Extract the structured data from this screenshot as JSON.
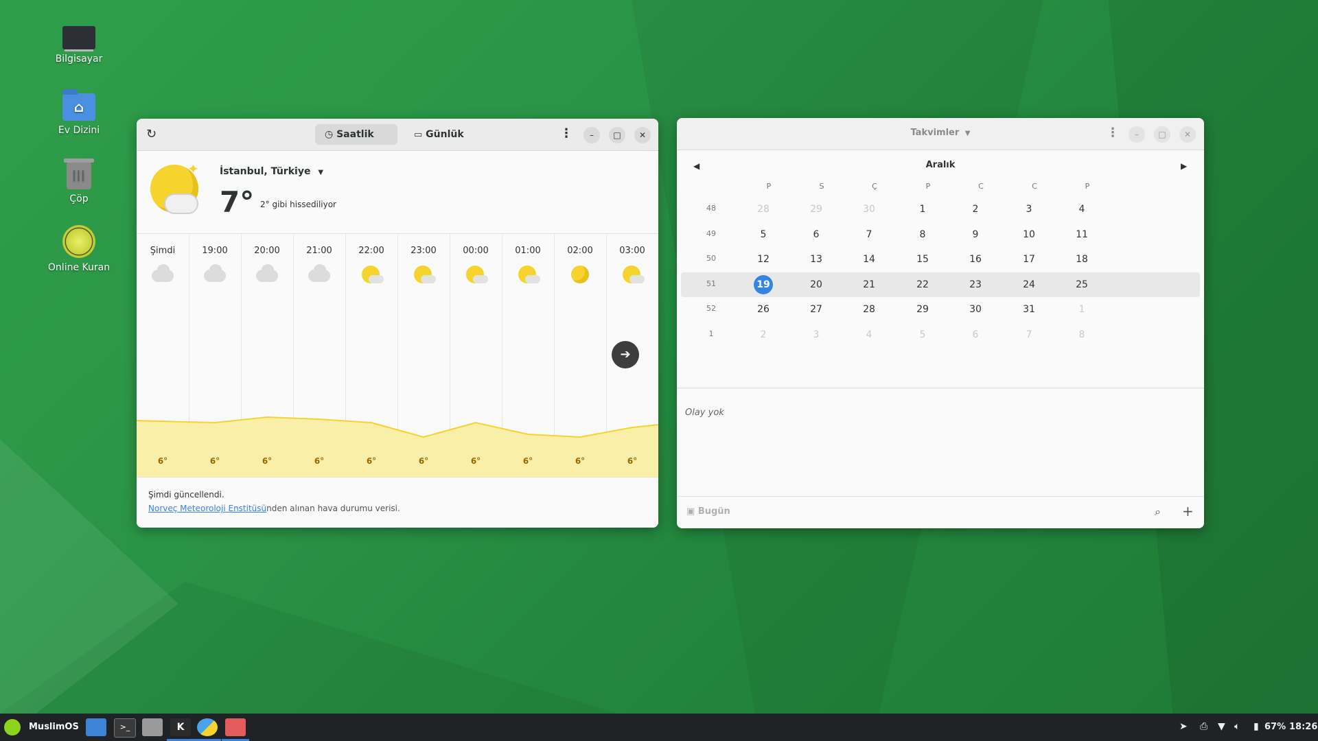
{
  "desktop": {
    "icons": [
      {
        "label": "Bilgisayar",
        "icon": "computer-icon"
      },
      {
        "label": "Ev Dizini",
        "icon": "home-folder-icon"
      },
      {
        "label": "Çöp",
        "icon": "trash-icon"
      },
      {
        "label": "Online Kuran",
        "icon": "quran-icon"
      }
    ]
  },
  "weather": {
    "tabs": {
      "hourly": "Saatlik",
      "daily": "Günlük"
    },
    "location": "İstanbul, Türkiye",
    "temperature": "7°",
    "feels_like": "2° gibi hissediliyor",
    "hours": [
      {
        "time": "Şimdi",
        "icon": "cloudy",
        "temp": "6°"
      },
      {
        "time": "19:00",
        "icon": "cloudy",
        "temp": "6°"
      },
      {
        "time": "20:00",
        "icon": "cloudy",
        "temp": "6°"
      },
      {
        "time": "21:00",
        "icon": "cloudy",
        "temp": "6°"
      },
      {
        "time": "22:00",
        "icon": "partly-cloudy-night",
        "temp": "6°"
      },
      {
        "time": "23:00",
        "icon": "partly-cloudy-night",
        "temp": "6°"
      },
      {
        "time": "00:00",
        "icon": "partly-cloudy-night",
        "temp": "6°"
      },
      {
        "time": "01:00",
        "icon": "partly-cloudy-night",
        "temp": "6°"
      },
      {
        "time": "02:00",
        "icon": "clear-night",
        "temp": "6°"
      },
      {
        "time": "03:00",
        "icon": "partly-cloudy-night",
        "temp": "6°"
      }
    ],
    "updated": "Şimdi güncellendi.",
    "source_link": "Norveç Meteoroloji Enstitüsü",
    "source_suffix": "nden alınan hava durumu verisi.",
    "accent": "#f6d32d"
  },
  "calendar": {
    "title": "Takvimler",
    "month": "Aralık",
    "weekdays": [
      "P",
      "S",
      "Ç",
      "P",
      "C",
      "C",
      "P"
    ],
    "weeks": [
      {
        "no": "48",
        "days": [
          "28",
          "29",
          "30",
          "1",
          "2",
          "3",
          "4"
        ],
        "dim": [
          true,
          true,
          true,
          false,
          false,
          false,
          false
        ]
      },
      {
        "no": "49",
        "days": [
          "5",
          "6",
          "7",
          "8",
          "9",
          "10",
          "11"
        ],
        "dim": [
          false,
          false,
          false,
          false,
          false,
          false,
          false
        ]
      },
      {
        "no": "50",
        "days": [
          "12",
          "13",
          "14",
          "15",
          "16",
          "17",
          "18"
        ],
        "dim": [
          false,
          false,
          false,
          false,
          false,
          false,
          false
        ]
      },
      {
        "no": "51",
        "days": [
          "19",
          "20",
          "21",
          "22",
          "23",
          "24",
          "25"
        ],
        "dim": [
          false,
          false,
          false,
          false,
          false,
          false,
          false
        ]
      },
      {
        "no": "52",
        "days": [
          "26",
          "27",
          "28",
          "29",
          "30",
          "31",
          "1"
        ],
        "dim": [
          false,
          false,
          false,
          false,
          false,
          false,
          true
        ]
      },
      {
        "no": "1",
        "days": [
          "2",
          "3",
          "4",
          "5",
          "6",
          "7",
          "8"
        ],
        "dim": [
          true,
          true,
          true,
          true,
          true,
          true,
          true
        ]
      }
    ],
    "current_week_index": 3,
    "today": "19",
    "no_events": "Olay yok",
    "today_button": "Bugün",
    "accent": "#3584e4"
  },
  "taskbar": {
    "menu_label": "MuslimOS",
    "apps": [
      "files-icon",
      "terminal-icon",
      "archive-icon",
      "kiwix-icon",
      "weather-icon",
      "calendar-icon"
    ],
    "battery": "67%",
    "clock": "18:26"
  }
}
